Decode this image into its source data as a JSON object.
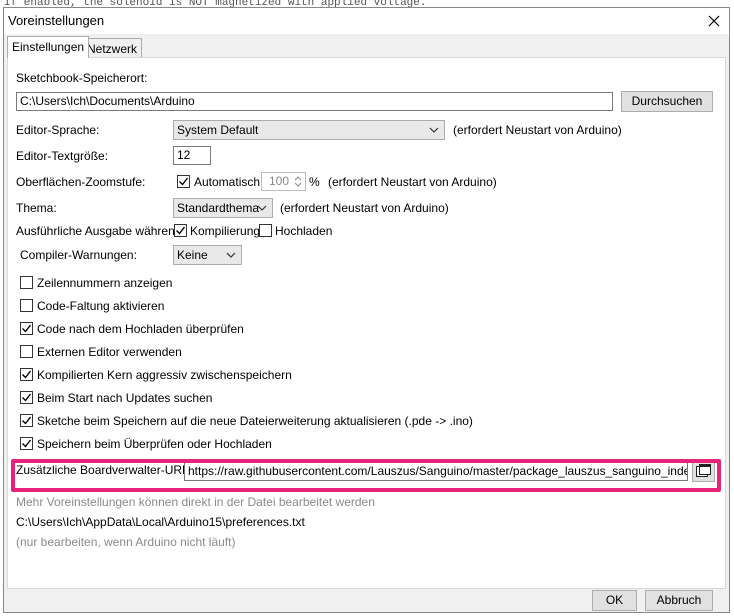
{
  "background": {
    "text": "If enabled, the solenoid is NOT magnetized with applied voltage."
  },
  "dialog": {
    "title": "Voreinstellungen"
  },
  "tabs": [
    {
      "label": "Einstellungen",
      "active": true
    },
    {
      "label": "Netzwerk",
      "active": false
    }
  ],
  "sketchbook": {
    "label": "Sketchbook-Speicherort:",
    "path": "C:\\Users\\Ich\\Documents\\Arduino",
    "browse_label": "Durchsuchen"
  },
  "editor_language": {
    "label": "Editor-Sprache:",
    "value": "System Default",
    "note": "(erfordert Neustart von Arduino)"
  },
  "editor_fontsize": {
    "label": "Editor-Textgröße:",
    "value": "12"
  },
  "zoom": {
    "label": "Oberflächen-Zoomstufe:",
    "auto_label": "Automatisch",
    "auto_checked": true,
    "value": "100",
    "unit": "%",
    "note": "(erfordert Neustart von Arduino)"
  },
  "theme": {
    "label": "Thema:",
    "value": "Standardthema",
    "note": "(erfordert Neustart von Arduino)"
  },
  "verbose": {
    "label": "Ausführliche Ausgabe während:",
    "compile_label": "Kompilierung",
    "compile_checked": true,
    "upload_label": "Hochladen",
    "upload_checked": false
  },
  "compiler_warnings": {
    "label": "Compiler-Warnungen:",
    "value": "Keine"
  },
  "options": [
    {
      "label": "Zeilennummern anzeigen",
      "checked": false
    },
    {
      "label": "Code-Faltung aktivieren",
      "checked": false
    },
    {
      "label": "Code nach dem Hochladen überprüfen",
      "checked": true
    },
    {
      "label": "Externen Editor verwenden",
      "checked": false
    },
    {
      "label": "Kompilierten Kern aggressiv zwischenspeichern",
      "checked": true
    },
    {
      "label": "Beim Start nach Updates suchen",
      "checked": true
    },
    {
      "label": "Sketche beim Speichern auf die neue Dateierweiterung aktualisieren (.pde -> .ino)",
      "checked": true
    },
    {
      "label": "Speichern beim Überprüfen oder Hochladen",
      "checked": true
    }
  ],
  "board_urls": {
    "label": "Zusätzliche Boardverwalter-URLs:",
    "value": "https://raw.githubusercontent.com/Lauszus/Sanguino/master/package_lauszus_sanguino_index.json",
    "button_icon": "window-list-icon"
  },
  "more_prefs": {
    "hint": "Mehr Voreinstellungen können direkt in der Datei bearbeitet werden",
    "path": "C:\\Users\\Ich\\AppData\\Local\\Arduino15\\preferences.txt",
    "note": "(nur bearbeiten, wenn Arduino nicht läuft)"
  },
  "footer": {
    "ok_label": "OK",
    "cancel_label": "Abbruch"
  },
  "colors": {
    "highlight": "#e8237b",
    "dialog_bg": "#f0f0f0",
    "panel_bg": "#ffffff"
  }
}
